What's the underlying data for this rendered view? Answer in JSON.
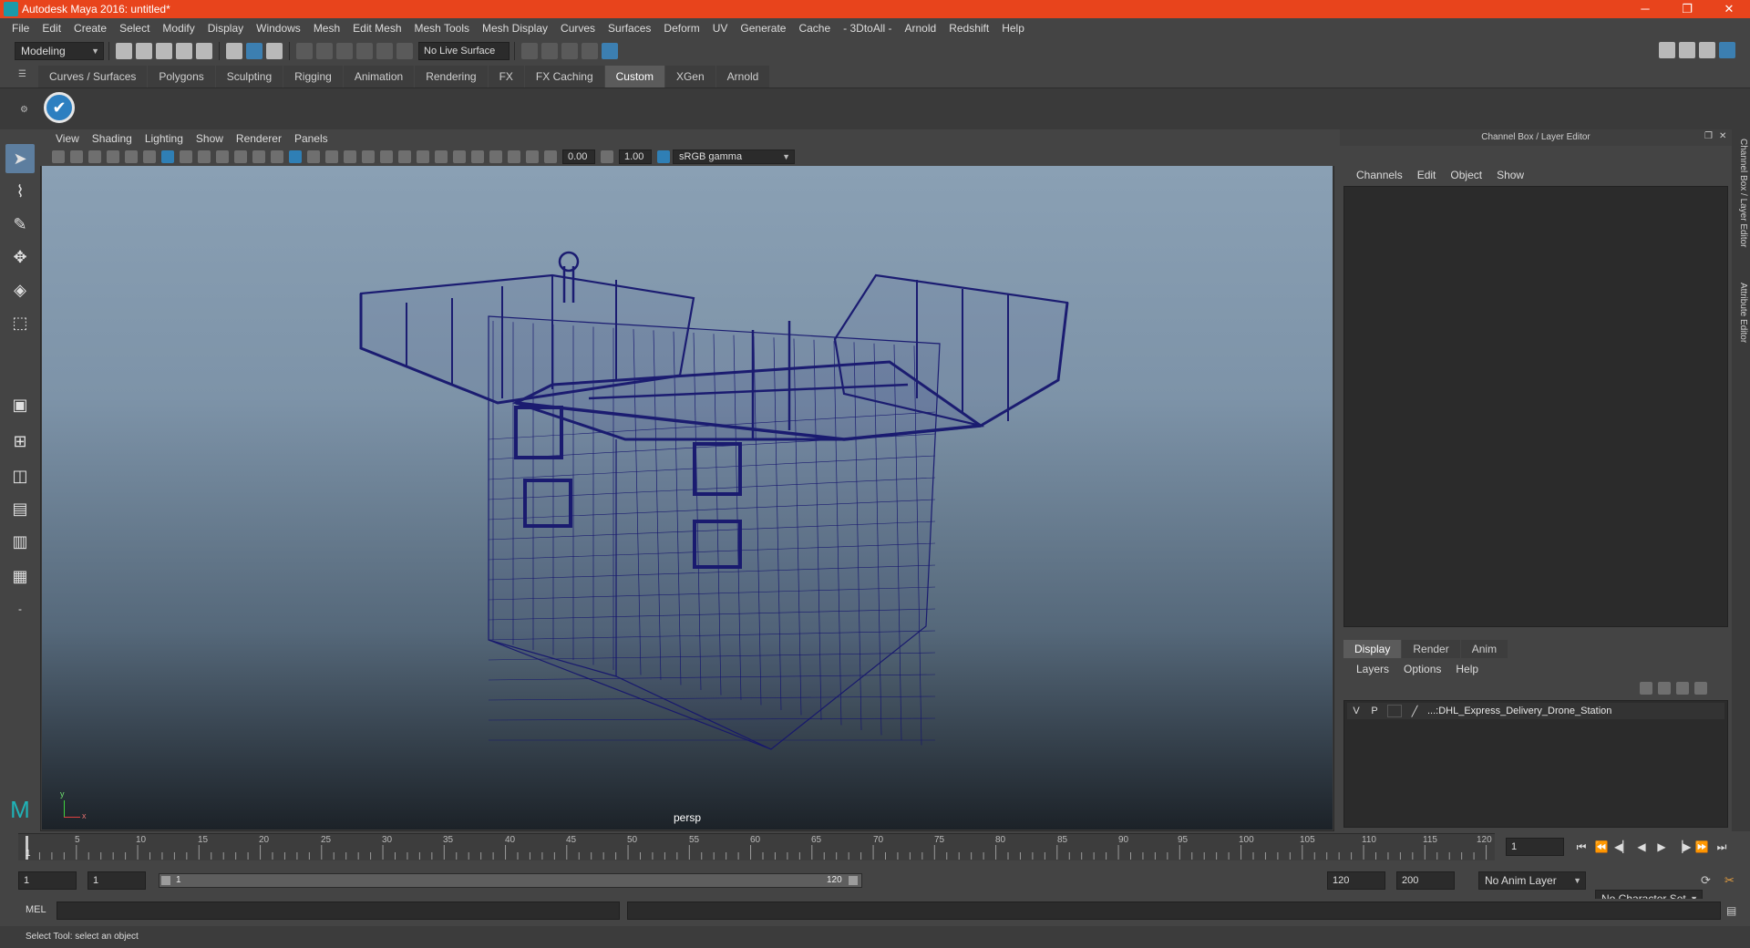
{
  "window": {
    "title": "Autodesk Maya 2016: untitled*",
    "minimize": "─",
    "maximize": "❐",
    "close": "✕"
  },
  "menubar": [
    "File",
    "Edit",
    "Create",
    "Select",
    "Modify",
    "Display",
    "Windows",
    "Mesh",
    "Edit Mesh",
    "Mesh Tools",
    "Mesh Display",
    "Curves",
    "Surfaces",
    "Deform",
    "UV",
    "Generate",
    "Cache",
    "- 3DtoAll -",
    "Arnold",
    "Redshift",
    "Help"
  ],
  "statusline": {
    "mode": "Modeling",
    "live_surface": "No Live Surface"
  },
  "shelf": {
    "tabs": [
      "Curves / Surfaces",
      "Polygons",
      "Sculpting",
      "Rigging",
      "Animation",
      "Rendering",
      "FX",
      "FX Caching",
      "Custom",
      "XGen",
      "Arnold"
    ],
    "active_tab": "Custom",
    "button_glyph": "✔"
  },
  "viewport": {
    "menu": [
      "View",
      "Shading",
      "Lighting",
      "Show",
      "Renderer",
      "Panels"
    ],
    "exposure": "0.00",
    "gamma": "1.00",
    "color_space": "sRGB gamma",
    "camera": "persp",
    "axis_x": "x",
    "axis_y": "y"
  },
  "channel_box": {
    "header": "Channel Box / Layer Editor",
    "menu": [
      "Channels",
      "Edit",
      "Object",
      "Show"
    ]
  },
  "layer_editor": {
    "tabs": [
      "Display",
      "Render",
      "Anim"
    ],
    "active_tab": "Display",
    "menu": [
      "Layers",
      "Options",
      "Help"
    ],
    "layer": {
      "visible": "V",
      "playback": "P",
      "name": "...:DHL_Express_Delivery_Drone_Station"
    }
  },
  "side_tabs": [
    "Channel Box / Layer Editor",
    "Attribute Editor"
  ],
  "timeline": {
    "ticks": [
      "5",
      "10",
      "15",
      "20",
      "25",
      "30",
      "35",
      "40",
      "45",
      "50",
      "55",
      "60",
      "65",
      "70",
      "75",
      "80",
      "85",
      "90",
      "95",
      "100",
      "105",
      "110",
      "115",
      "120"
    ],
    "first_frame": "1",
    "current_frame": "1"
  },
  "range": {
    "start": "1",
    "playback_start": "1",
    "slider_start": "1",
    "slider_end": "120",
    "playback_end": "120",
    "end": "200",
    "anim_layer": "No Anim Layer",
    "character_set": "No Character Set"
  },
  "command_line": {
    "label": "MEL"
  },
  "help_line": "Select Tool: select an object"
}
